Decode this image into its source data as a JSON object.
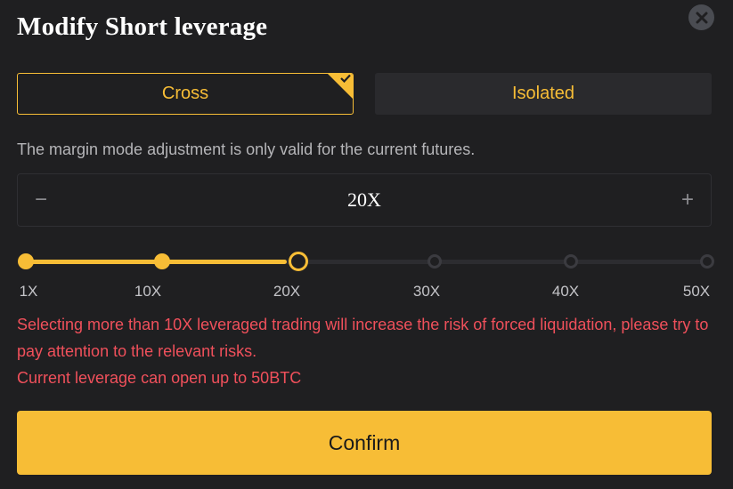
{
  "dialog": {
    "title": "Modify Short leverage",
    "close_icon": "close-icon"
  },
  "margin_mode": {
    "options": [
      {
        "label": "Cross",
        "selected": true
      },
      {
        "label": "Isolated",
        "selected": false
      }
    ],
    "info": "The margin mode adjustment is only valid for the current futures."
  },
  "leverage": {
    "minus_label": "−",
    "plus_label": "+",
    "value": "20X",
    "slider": {
      "ticks": [
        "1X",
        "10X",
        "20X",
        "30X",
        "40X",
        "50X"
      ],
      "current_index": 2
    }
  },
  "warning": {
    "line1": "Selecting more than 10X leveraged trading will increase the risk of forced liquidation, please try to pay attention to the relevant risks.",
    "line2": "Current leverage can open up to 50BTC"
  },
  "confirm_label": "Confirm",
  "colors": {
    "accent": "#f7bd36",
    "warning": "#f0505b",
    "background": "#1f1f21"
  }
}
